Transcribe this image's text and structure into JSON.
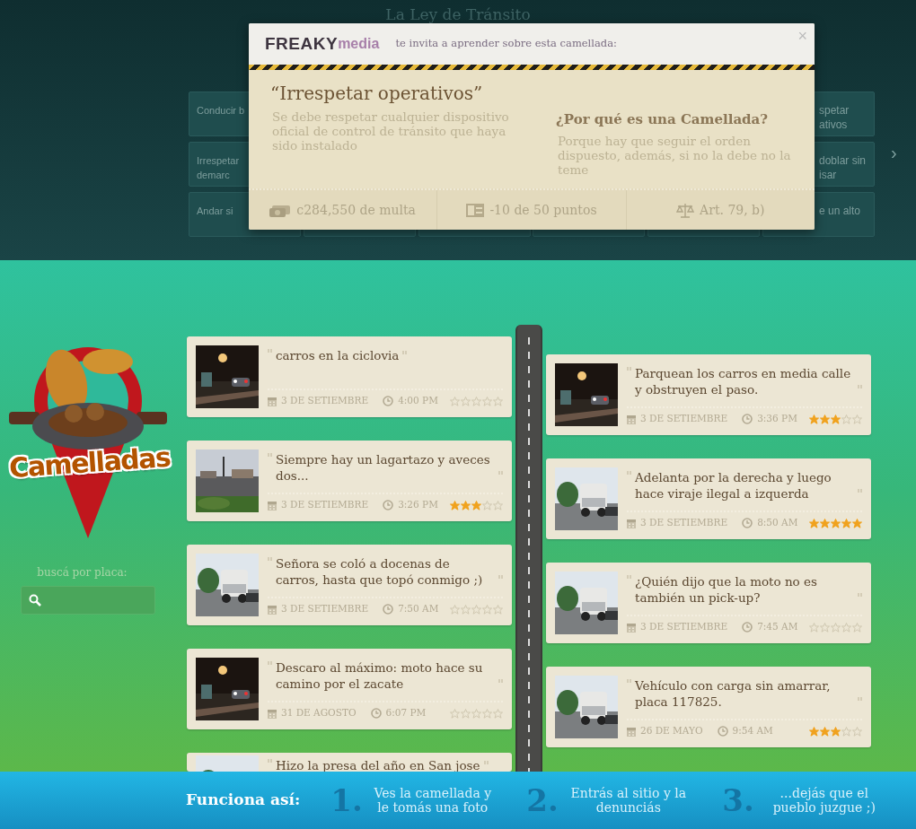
{
  "background": {
    "title": "La Ley de Tránsito",
    "next": "›",
    "rows": [
      {
        "left": [
          "Conducir b"
        ],
        "right": [
          "spetar",
          "ativos"
        ]
      },
      {
        "left": [
          "Irrespetar",
          "demarc"
        ],
        "right": [
          "doblar sin",
          "isar"
        ]
      },
      {
        "left": [
          "Andar si"
        ],
        "right": [
          "e un alto"
        ]
      }
    ]
  },
  "modal": {
    "brand_bold": "FREAKY",
    "brand_light": "media",
    "invite": "te invita a aprender sobre esta camellada:",
    "close": "×",
    "title": "“Irrespetar operativos”",
    "description": "Se debe respetar cualquier dispositivo oficial de control de tránsito que haya sido instalado",
    "question": "¿Por qué es una Camellada?",
    "answer": "Porque hay que seguir el orden dispuesto, además, si no la debe no la teme",
    "facts": [
      {
        "kind": "fine",
        "text": "c284,550 de multa"
      },
      {
        "kind": "points",
        "text": "-10 de 50 puntos"
      },
      {
        "kind": "article",
        "text": "Art. 79, b)"
      }
    ]
  },
  "logo": {
    "text": "Camelladas"
  },
  "search": {
    "label": "buscá por placa:"
  },
  "timeline": {
    "left": [
      {
        "text": "carros en la ciclovia",
        "date": "3 DE SETIEMBRE",
        "time": "4:00 PM",
        "stars": 0
      },
      {
        "text": "Siempre hay un lagartazo y aveces dos...",
        "date": "3 DE SETIEMBRE",
        "time": "3:26 PM",
        "stars": 3
      },
      {
        "text": "Señora se coló a docenas de carros, hasta que topó conmigo ;)",
        "date": "3 DE SETIEMBRE",
        "time": "7:50 AM",
        "stars": 0
      },
      {
        "text": "Descaro al máximo: moto hace su camino por el zacate",
        "date": "31 DE AGOSTO",
        "time": "6:07 PM",
        "stars": 0
      },
      {
        "text": "Hizo la presa del año en San jose"
      }
    ],
    "right": [
      {
        "text": "Parquean los carros en media calle y obstruyen el paso.",
        "date": "3 DE SETIEMBRE",
        "time": "3:36 PM",
        "stars": 3
      },
      {
        "text": "Adelanta por la derecha y luego hace viraje ilegal a izquerda",
        "date": "3 DE SETIEMBRE",
        "time": "8:50 AM",
        "stars": 5
      },
      {
        "text": "¿Quién dijo que la moto no es también un pick-up?",
        "date": "3 DE SETIEMBRE",
        "time": "7:45 AM",
        "stars": 0
      },
      {
        "text": "Vehículo con carga sin amarrar, placa 117825.",
        "date": "26 DE MAYO",
        "time": "9:54 AM",
        "stars": 3
      }
    ]
  },
  "footer": {
    "title": "Funciona así:",
    "steps": [
      {
        "number": "1.",
        "text": "Ves la camellada y le tomás una foto"
      },
      {
        "number": "2.",
        "text": "Entrás al sitio y la denunciás"
      },
      {
        "number": "3.",
        "text": "...dejás que el pueblo juzgue ;)"
      }
    ]
  }
}
